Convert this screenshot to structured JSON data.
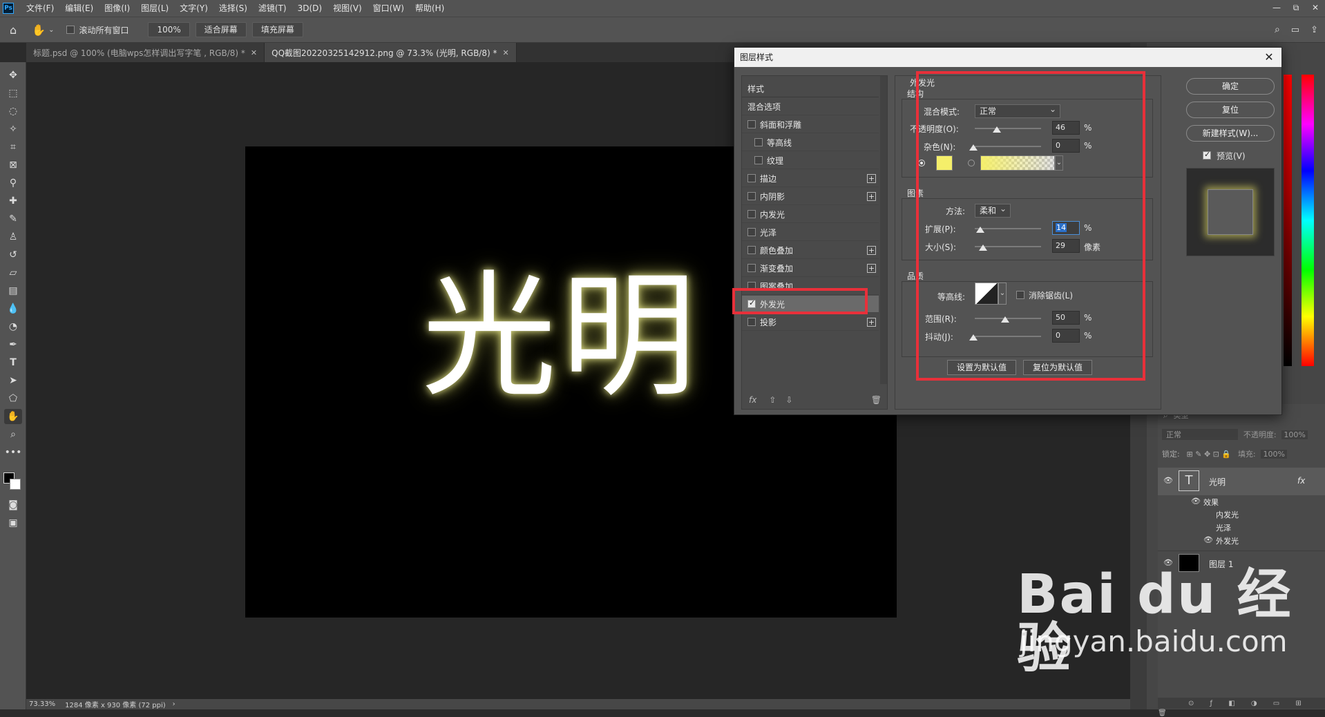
{
  "menu": {
    "app_logo": "Ps",
    "items": [
      "文件(F)",
      "编辑(E)",
      "图像(I)",
      "图层(L)",
      "文字(Y)",
      "选择(S)",
      "滤镜(T)",
      "3D(D)",
      "视图(V)",
      "窗口(W)",
      "帮助(H)"
    ]
  },
  "window_controls": {
    "minimize": "—",
    "restore": "⧉",
    "close": "✕"
  },
  "options_bar": {
    "scroll_all": "滚动所有窗口",
    "zoom_value": "100%",
    "fit_screen": "适合屏幕",
    "fill_screen": "填充屏幕"
  },
  "tabs": [
    {
      "label": "标题.psd @ 100% (电脑wps怎样调出写字笔 , RGB/8) *",
      "active": false
    },
    {
      "label": "QQ截图20220325142912.png @ 73.3% (光明, RGB/8) *",
      "active": true
    }
  ],
  "canvas": {
    "text": "光明"
  },
  "status": {
    "zoom": "73.33%",
    "size": "1284 像素 x 930 像素 (72 ppi)"
  },
  "dialog": {
    "title": "图层样式",
    "style_list": {
      "header": "样式",
      "items": [
        {
          "label": "混合选项",
          "check": false,
          "has_check": false,
          "indent": false,
          "plus": false,
          "selected": false
        },
        {
          "label": "斜面和浮雕",
          "check": false,
          "has_check": true,
          "indent": false,
          "plus": false,
          "selected": false
        },
        {
          "label": "等高线",
          "check": false,
          "has_check": true,
          "indent": true,
          "plus": false,
          "selected": false
        },
        {
          "label": "纹理",
          "check": false,
          "has_check": true,
          "indent": true,
          "plus": false,
          "selected": false
        },
        {
          "label": "描边",
          "check": false,
          "has_check": true,
          "indent": false,
          "plus": true,
          "selected": false
        },
        {
          "label": "内阴影",
          "check": false,
          "has_check": true,
          "indent": false,
          "plus": true,
          "selected": false
        },
        {
          "label": "内发光",
          "check": false,
          "has_check": true,
          "indent": false,
          "plus": false,
          "selected": false
        },
        {
          "label": "光泽",
          "check": false,
          "has_check": true,
          "indent": false,
          "plus": false,
          "selected": false
        },
        {
          "label": "颜色叠加",
          "check": false,
          "has_check": true,
          "indent": false,
          "plus": true,
          "selected": false
        },
        {
          "label": "渐变叠加",
          "check": false,
          "has_check": true,
          "indent": false,
          "plus": true,
          "selected": false
        },
        {
          "label": "图案叠加",
          "check": false,
          "has_check": true,
          "indent": false,
          "plus": false,
          "selected": false
        },
        {
          "label": "外发光",
          "check": true,
          "has_check": true,
          "indent": false,
          "plus": false,
          "selected": true
        },
        {
          "label": "投影",
          "check": false,
          "has_check": true,
          "indent": false,
          "plus": true,
          "selected": false
        }
      ],
      "footer_fx": "fx"
    },
    "outer_glow": {
      "section_title": "外发光",
      "structure": {
        "title": "结构",
        "blend_mode_label": "混合模式:",
        "blend_mode_value": "正常",
        "opacity_label": "不透明度(O):",
        "opacity_value": "46",
        "opacity_unit": "%",
        "noise_label": "杂色(N):",
        "noise_value": "0",
        "noise_unit": "%",
        "glow_color": "#f5ef6a"
      },
      "elements": {
        "title": "图素",
        "technique_label": "方法:",
        "technique_value": "柔和",
        "spread_label": "扩展(P):",
        "spread_value": "14",
        "spread_unit": "%",
        "size_label": "大小(S):",
        "size_value": "29",
        "size_unit": "像素"
      },
      "quality": {
        "title": "品质",
        "contour_label": "等高线:",
        "anti_alias_label": "消除锯齿(L)",
        "range_label": "范围(R):",
        "range_value": "50",
        "range_unit": "%",
        "jitter_label": "抖动(J):",
        "jitter_value": "0",
        "jitter_unit": "%"
      },
      "make_default": "设置为默认值",
      "reset_default": "复位为默认值"
    },
    "buttons": {
      "ok": "确定",
      "reset": "复位",
      "new_style": "新建样式(W)...",
      "preview_label": "预览(V)"
    }
  },
  "layers_panel": {
    "search_placeholder": "类型",
    "blend_mode": "正常",
    "opacity_label": "不透明度:",
    "opacity_value": "100%",
    "lock_label": "锁定:",
    "fill_label": "填充:",
    "fill_value": "100%",
    "layers": [
      {
        "name": "光明",
        "type": "text",
        "fx": "fx"
      },
      {
        "name": "效果",
        "type": "effects-header"
      },
      {
        "name": "内发光",
        "type": "effect"
      },
      {
        "name": "光泽",
        "type": "effect"
      },
      {
        "name": "外发光",
        "type": "effect"
      },
      {
        "name": "图层 1",
        "type": "pixel"
      }
    ]
  },
  "watermark": {
    "brand": "Bai du 经验",
    "url": "jingyan.baidu.com"
  },
  "colors": {
    "highlight_red": "#e8303a",
    "accent_blue": "#2a6fc9"
  }
}
